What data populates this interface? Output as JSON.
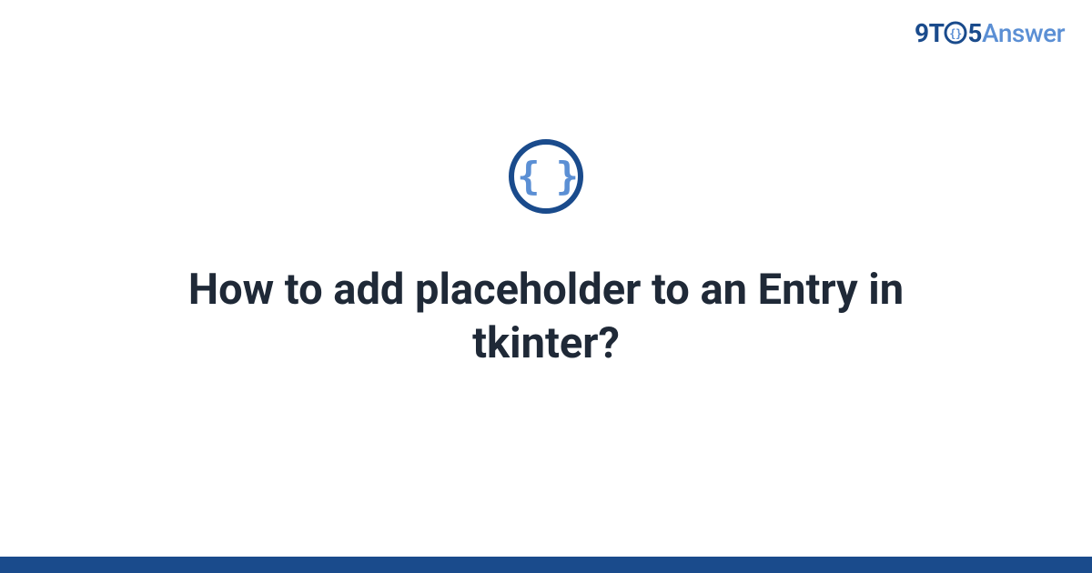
{
  "brand": {
    "part1": "9T",
    "part2": "5",
    "part3": "Answer"
  },
  "icon": {
    "glyph": "{ }"
  },
  "question": {
    "title": "How to add placeholder to an Entry in tkinter?"
  },
  "colors": {
    "primary": "#1a4b8c",
    "accent": "#5b8fd4",
    "text": "#1f2937"
  }
}
